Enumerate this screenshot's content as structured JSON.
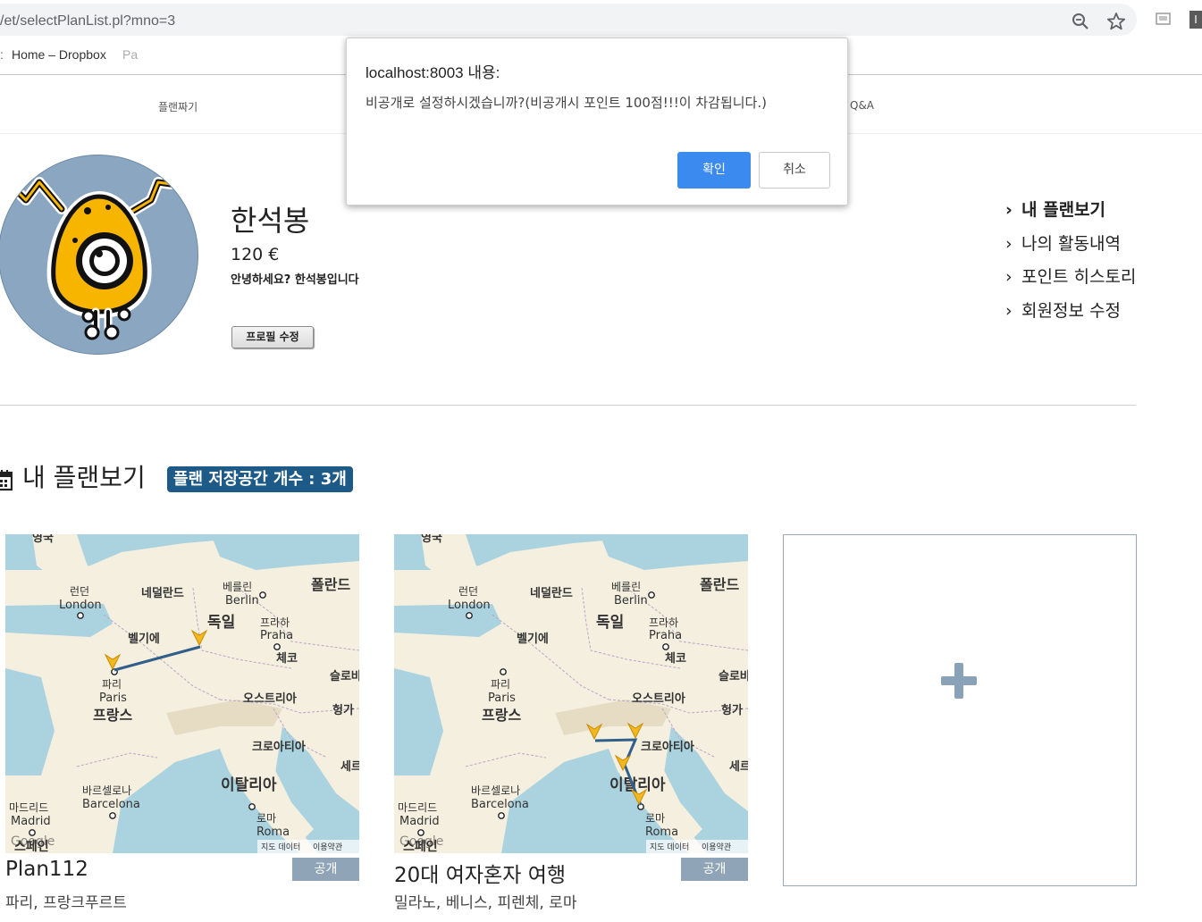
{
  "browser": {
    "url": "/et/selectPlanList.pl?mno=3",
    "bookmark_prefix": ":",
    "bookmark_home": "Home – Dropbox",
    "bookmark_cut": "Pa",
    "ext_label": "I",
    "icons": [
      "zoom-out-icon",
      "star-icon",
      "extension-icon"
    ]
  },
  "nav": {
    "plan_label": "플랜짜기",
    "qna_label": "Q&A"
  },
  "profile": {
    "name": "한석봉",
    "points": "120 €",
    "greeting": "안녕하세요? 한석봉입니다",
    "edit_label": "프로필 수정"
  },
  "side_menu": {
    "items": [
      {
        "label": "내 플랜보기",
        "active": true
      },
      {
        "label": "나의 활동내역",
        "active": false
      },
      {
        "label": "포인트 히스토리",
        "active": false
      },
      {
        "label": "회원정보 수정",
        "active": false
      }
    ]
  },
  "section": {
    "title": "내 플랜보기",
    "badge": "플랜 저장공간 개수 : 3개"
  },
  "map_labels": {
    "uk": "영국",
    "london_ko": "런던",
    "london_en": "London",
    "netherlands": "네덜란드",
    "berlin_ko": "베를린",
    "berlin_en": "Berlin",
    "poland": "폴란드",
    "germany": "독일",
    "belgium": "벨기에",
    "prague_ko": "프라하",
    "prague_en": "Praha",
    "czech": "체코",
    "slovakia": "슬로바",
    "paris_ko": "파리",
    "paris_en": "Paris",
    "france": "프랑스",
    "austria": "오스트리아",
    "hungary": "헝가",
    "croatia": "크로아티아",
    "serbia": "세르",
    "barcelona_ko": "바르셀로나",
    "barcelona_en": "Barcelona",
    "italy": "이탈리아",
    "madrid_ko": "마드리드",
    "madrid_en": "Madrid",
    "rome_ko": "로마",
    "rome_en": "Roma",
    "spain": "스페인",
    "google": "Google",
    "map_data": "지도 데이터",
    "terms": "이용약관"
  },
  "plans": [
    {
      "title": "Plan112",
      "status": "공개",
      "cities": "파리, 프랑크푸르트"
    },
    {
      "title": "20대 여자혼자 여행",
      "status": "공개",
      "cities": "밀라노, 베니스, 피렌체, 로마"
    }
  ],
  "add_card": {
    "icon": "plus-icon"
  },
  "dialog": {
    "title": "localhost:8003 내용:",
    "message": "비공개로 설정하시겠습니까?(비공개시 포인트 100점!!!이 차감됩니다.)",
    "ok_label": "확인",
    "cancel_label": "취소"
  },
  "colors": {
    "accent_button": "#3b8aef",
    "badge_bg": "#1e5a87",
    "status_badge": "#90a4b8",
    "route_line": "#2f5f8a",
    "marker": "#f2b821"
  }
}
